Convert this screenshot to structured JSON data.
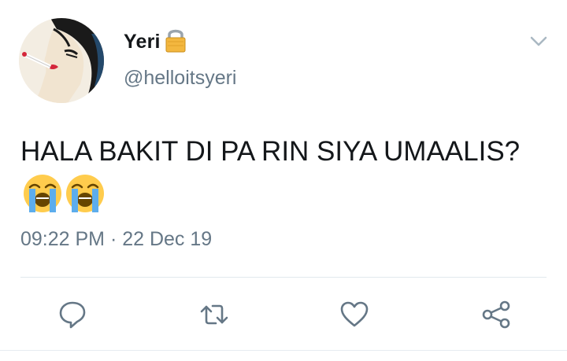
{
  "tweet": {
    "display_name": "Yeri",
    "handle": "@helloitsyeri",
    "text": "HALA BAKIT DI PA RIN SIYA UMAALIS?",
    "emojis": [
      "loudly-crying-face",
      "loudly-crying-face"
    ],
    "timestamp": "09:22 PM · 22 Dec 19",
    "protected_account_icon": "lock-icon"
  },
  "actions": [
    "reply-icon",
    "retweet-icon",
    "like-icon",
    "share-icon"
  ],
  "colors": {
    "text": "#14171a",
    "secondary": "#657786",
    "divider": "#e1e8ed"
  }
}
